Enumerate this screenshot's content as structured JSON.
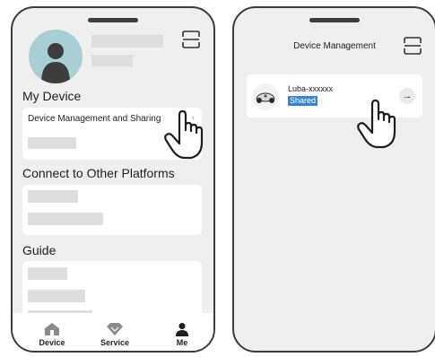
{
  "left_screen": {
    "section_my_device": "My Device",
    "device_management_row": "Device Management and Sharing",
    "chevron": "›",
    "section_connect": "Connect to Other Platforms",
    "section_guide": "Guide",
    "tabs": [
      {
        "label": "Device",
        "icon": "home-icon"
      },
      {
        "label": "Service",
        "icon": "diamond-icon"
      },
      {
        "label": "Me",
        "icon": "person-icon"
      }
    ]
  },
  "right_screen": {
    "title": "Device Management",
    "device": {
      "name": "Luba-xxxxxx",
      "badge": "Shared",
      "arrow": "→"
    }
  },
  "colors": {
    "accent_badge": "#3a84c9",
    "avatar_bg": "#a9cfd5",
    "screen_bg": "#efefef",
    "frame": "#3c3c3c"
  }
}
